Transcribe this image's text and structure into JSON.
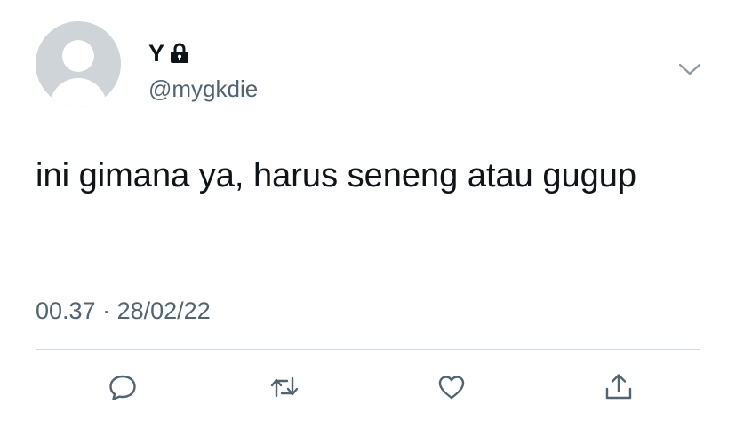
{
  "author": {
    "name": "Y",
    "handle": "@mygkdie"
  },
  "tweet": {
    "text": "ini gimana ya, harus seneng atau gugup",
    "time": "00.37",
    "separator": "·",
    "date": "28/02/22"
  },
  "icons": {
    "lock": "lock-icon",
    "menu": "chevron-down-icon",
    "reply": "reply-icon",
    "retweet": "retweet-icon",
    "like": "heart-icon",
    "share": "share-icon"
  },
  "colors": {
    "text_primary": "#0f1419",
    "text_secondary": "#536471",
    "divider": "#cfd9de",
    "avatar_bg": "#cfd4d9",
    "icon": "#536471"
  }
}
